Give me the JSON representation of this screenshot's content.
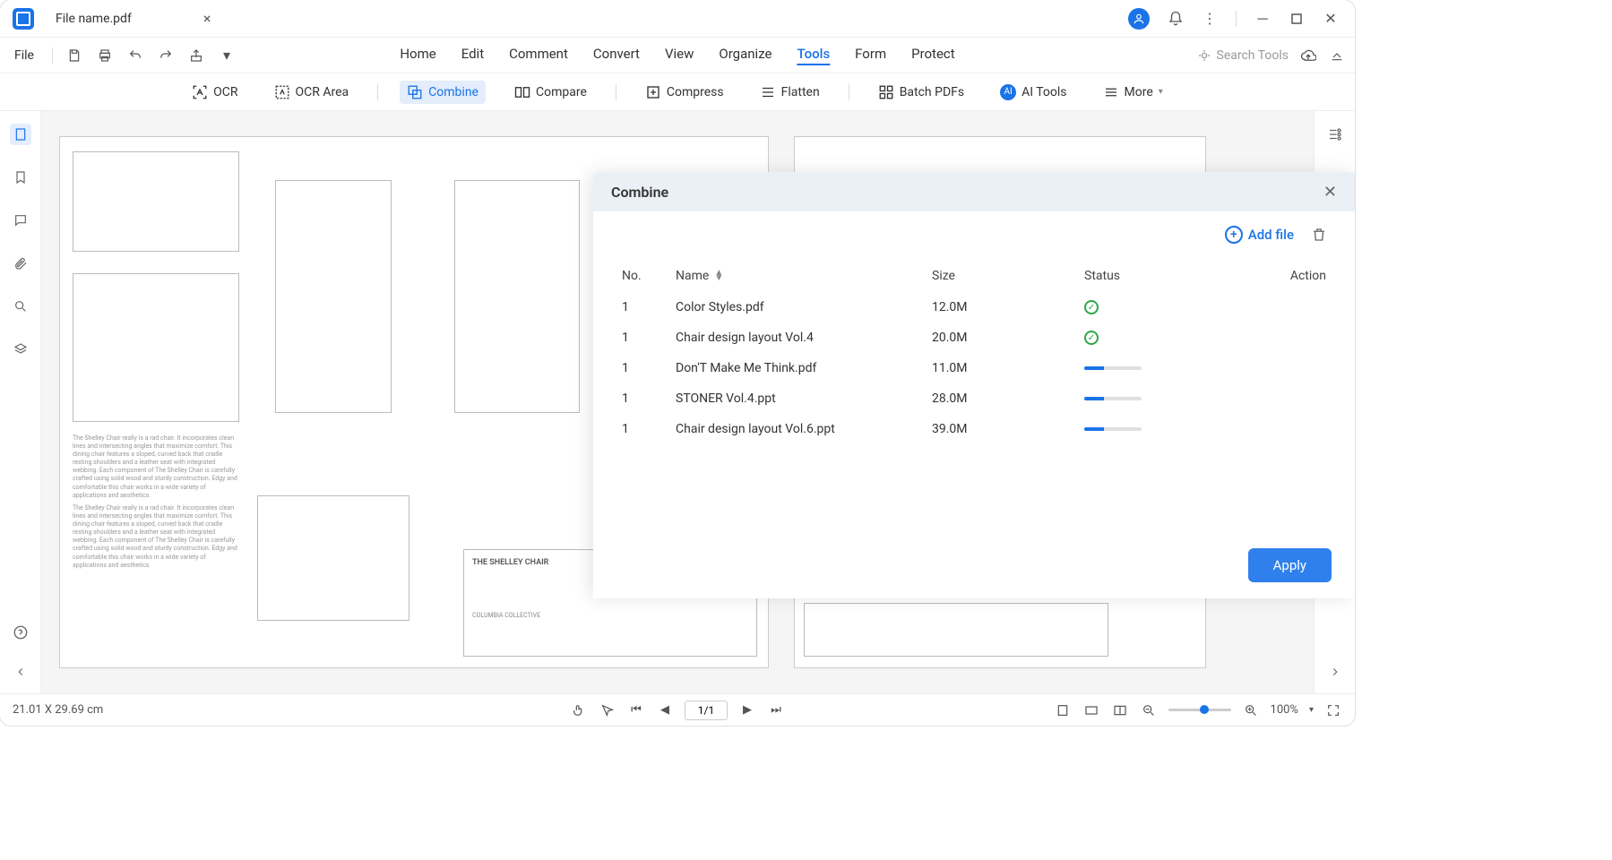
{
  "tab": {
    "filename": "File name.pdf",
    "close": "×"
  },
  "file_menu": "File",
  "menu": [
    "Home",
    "Edit",
    "Comment",
    "Convert",
    "View",
    "Organize",
    "Tools",
    "Form",
    "Protect"
  ],
  "menu_active": "Tools",
  "search_placeholder": "Search Tools",
  "ribbon": {
    "ocr": "OCR",
    "ocr_area": "OCR Area",
    "combine": "Combine",
    "compare": "Compare",
    "compress": "Compress",
    "flatten": "Flatten",
    "batch": "Batch PDFs",
    "ai": "AI Tools",
    "more": "More"
  },
  "page_size": "21.01 X 29.69 cm",
  "page_counter": "1/1",
  "zoom": "100%",
  "panel": {
    "title": "Combine",
    "add_file": "Add file",
    "headers": {
      "no": "No.",
      "name": "Name",
      "size": "Size",
      "status": "Status",
      "action": "Action"
    },
    "rows": [
      {
        "no": "1",
        "name": "Color Styles.pdf",
        "size": "12.0M",
        "status": "ok"
      },
      {
        "no": "1",
        "name": "Chair design layout Vol.4",
        "size": "20.0M",
        "status": "ok"
      },
      {
        "no": "1",
        "name": "Don'T Make Me Think.pdf",
        "size": "11.0M",
        "status": "progress",
        "pct": 35
      },
      {
        "no": "1",
        "name": "STONER Vol.4.ppt",
        "size": "28.0M",
        "status": "progress",
        "pct": 35
      },
      {
        "no": "1",
        "name": "Chair design layout Vol.6.ppt",
        "size": "39.0M",
        "status": "progress",
        "pct": 35
      }
    ],
    "apply": "Apply"
  },
  "doc": {
    "title": "THE SHELLEY CHAIR",
    "brand": "COLUMBIA COLLECTIVE"
  }
}
